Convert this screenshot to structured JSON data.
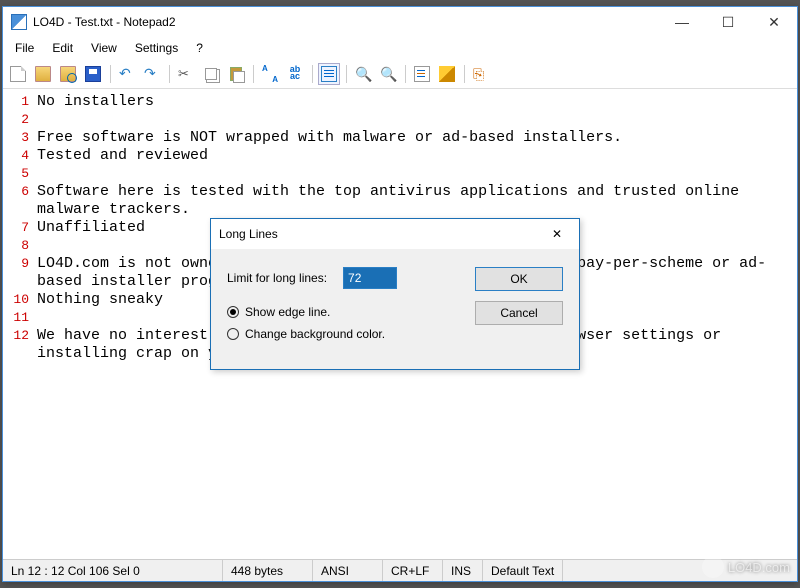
{
  "window": {
    "title": "LO4D - Test.txt - Notepad2",
    "min": "—",
    "max": "☐",
    "close": "✕"
  },
  "menu": {
    "file": "File",
    "edit": "Edit",
    "view": "View",
    "settings": "Settings",
    "help": "?"
  },
  "editor": {
    "lines": [
      "No installers",
      "",
      "Free software is NOT wrapped with malware or ad-based installers.",
      "Tested and reviewed",
      "",
      "Software here is tested with the top antivirus applications and trusted online malware trackers.",
      "Unaffiliated",
      "",
      "LO4D.com is not owned by, affiliated with or related to any pay-per-scheme or ad-based installer programs.",
      "Nothing sneaky",
      "",
      "We have no interest in modifying your homepage, changing browser settings or installing crap on your system."
    ],
    "line_numbers": [
      "1",
      "2",
      "3",
      "4",
      "5",
      "6",
      "7",
      "8",
      "9",
      "10",
      "11",
      "12"
    ]
  },
  "status": {
    "pos": "Ln 12 : 12   Col 106   Sel 0",
    "size": "448 bytes",
    "enc": "ANSI",
    "eol": "CR+LF",
    "mode": "INS",
    "syntax": "Default Text"
  },
  "dialog": {
    "title": "Long Lines",
    "close_glyph": "✕",
    "limit_label": "Limit for long lines:",
    "limit_value": "72",
    "opt_edge": "Show edge line.",
    "opt_bg": "Change background color.",
    "ok": "OK",
    "cancel": "Cancel"
  },
  "toolbar": {
    "new": "New",
    "open": "Open",
    "browse": "Browse",
    "save": "Save",
    "undo": "Undo",
    "redo": "Redo",
    "cut": "Cut",
    "copy": "Copy",
    "paste": "Paste",
    "find": "Find",
    "replace": "Replace",
    "wordwrap": "Word Wrap",
    "zoomin": "Zoom In",
    "zoomout": "Zoom Out",
    "scheme": "Scheme",
    "custom": "Customize",
    "exit": "Exit"
  },
  "watermark": "LO4D.com"
}
